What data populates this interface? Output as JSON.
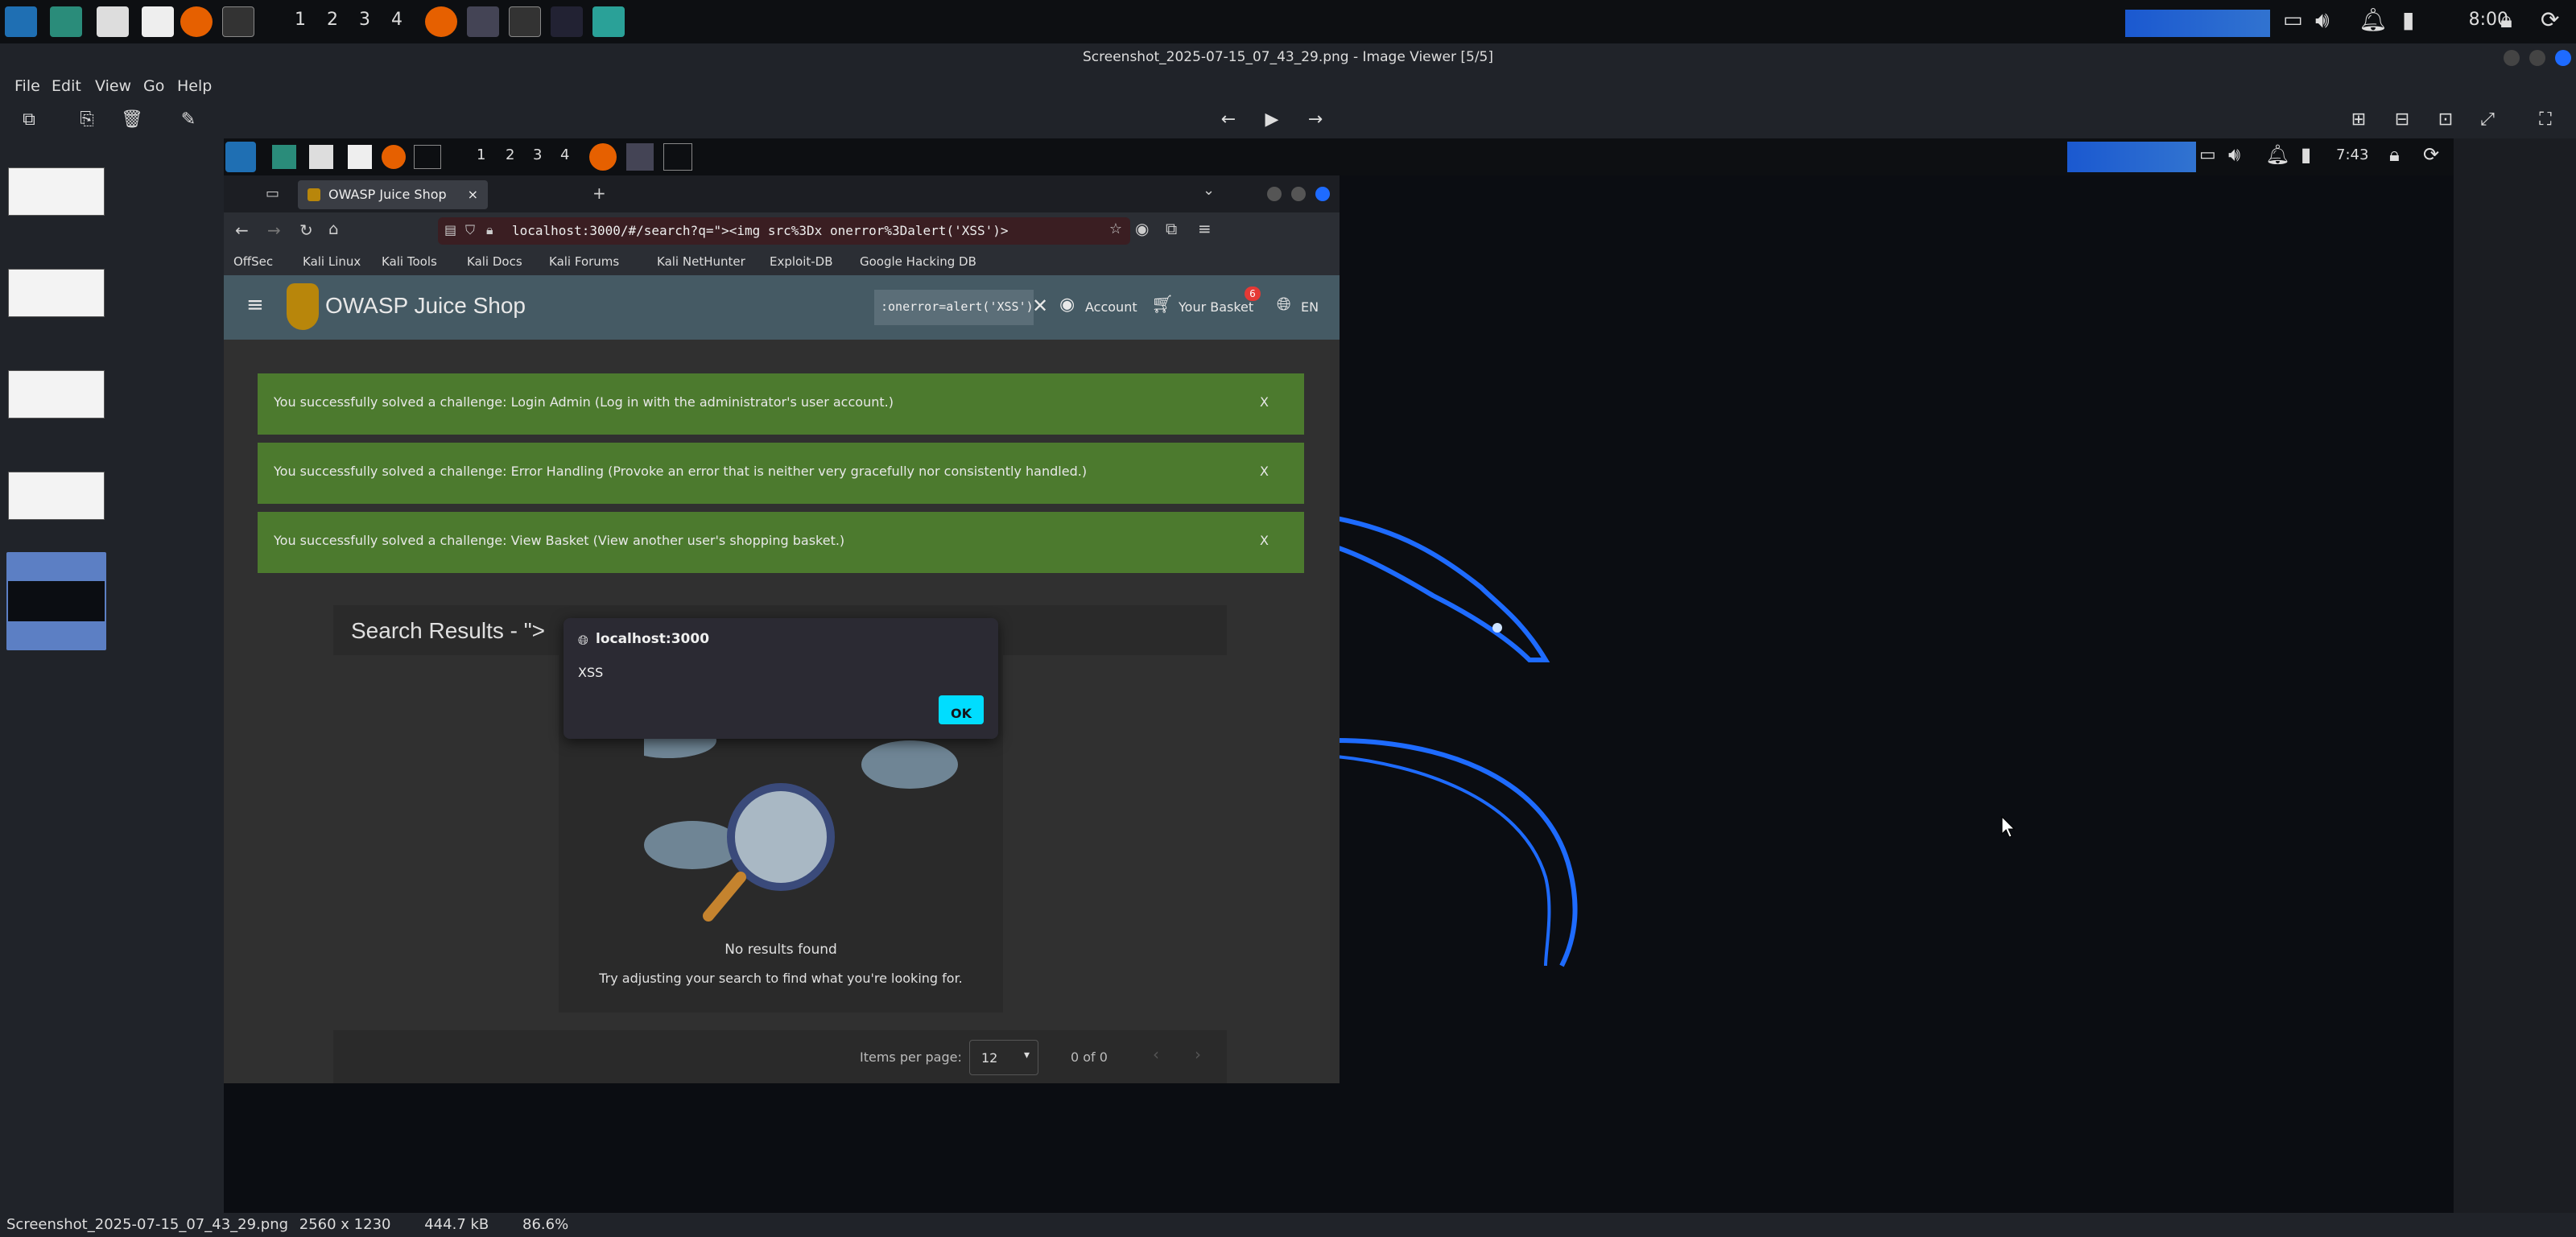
{
  "taskbar": {
    "workspaces": [
      "1",
      "2",
      "3",
      "4"
    ],
    "clock": "8:00"
  },
  "viewer": {
    "title": "Screenshot_2025-07-15_07_43_29.png - Image Viewer [5/5]",
    "menu": [
      "File",
      "Edit",
      "View",
      "Go",
      "Help"
    ],
    "status": {
      "filename": "Screenshot_2025-07-15_07_43_29.png",
      "dimensions": "2560 x 1230",
      "size": "444.7 kB",
      "zoom": "86.6%"
    }
  },
  "inner": {
    "workspaces": [
      "1",
      "2",
      "3",
      "4"
    ],
    "clock": "7:43",
    "firefox": {
      "tab_title": "OWASP Juice Shop",
      "url": "localhost:3000/#/search?q=\"><img src%3Dx onerror%3Dalert('XSS')>",
      "bookmarks": [
        "OffSec",
        "Kali Linux",
        "Kali Tools",
        "Kali Docs",
        "Kali Forums",
        "Kali NetHunter",
        "Exploit-DB",
        "Google Hacking DB"
      ]
    },
    "juiceshop": {
      "title": "OWASP Juice Shop",
      "search_value": ":onerror=alert('XSS')>",
      "account": "Account",
      "basket": "Your Basket",
      "basket_count": "6",
      "language": "EN",
      "alerts": [
        "You successfully solved a challenge: Login Admin (Log in with the administrator's user account.)",
        "You successfully solved a challenge: Error Handling (Provoke an error that is neither very gracefully nor consistently handled.)",
        "You successfully solved a challenge: View Basket (View another user's shopping basket.)"
      ],
      "alert_close": "X",
      "results_title": "Search Results - \">",
      "no_results": "No results found",
      "try_adjusting": "Try adjusting your search to find what you're looking for.",
      "items_per_page_label": "Items per page:",
      "items_per_page": "12",
      "range": "0 of 0"
    },
    "dialog": {
      "origin": "localhost:3000",
      "message": "XSS",
      "ok": "OK"
    }
  },
  "colors": {
    "alert_green": "#4c7a2e",
    "header": "#455a64",
    "ok_button": "#00ddff",
    "kali_blue": "#1e6bff"
  }
}
